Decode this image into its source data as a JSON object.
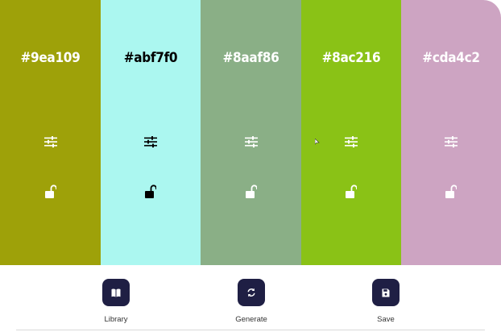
{
  "palette": {
    "colors": [
      {
        "hex": "#9ea109",
        "text_color": "#ffffff",
        "icon_color": "#ffffff",
        "adjust_icon": "sliders-icon",
        "lock_icon": "unlocked-icon"
      },
      {
        "hex": "#abf7f0",
        "text_color": "#000000",
        "icon_color": "#000000",
        "adjust_icon": "sliders-icon",
        "lock_icon": "unlocked-icon"
      },
      {
        "hex": "#8aaf86",
        "text_color": "#ffffff",
        "icon_color": "#ffffff",
        "adjust_icon": "sliders-icon",
        "lock_icon": "unlocked-icon"
      },
      {
        "hex": "#8ac216",
        "text_color": "#ffffff",
        "icon_color": "#ffffff",
        "adjust_icon": "sliders-icon",
        "lock_icon": "unlocked-icon"
      },
      {
        "hex": "#cda4c2",
        "text_color": "#ffffff",
        "icon_color": "#ffffff",
        "adjust_icon": "sliders-icon",
        "lock_icon": "unlocked-icon"
      }
    ]
  },
  "toolbar": {
    "button_color": "#1f1f44",
    "buttons": [
      {
        "label": "Library",
        "icon": "book-icon"
      },
      {
        "label": "Generate",
        "icon": "refresh-icon"
      },
      {
        "label": "Save",
        "icon": "save-icon"
      }
    ]
  }
}
